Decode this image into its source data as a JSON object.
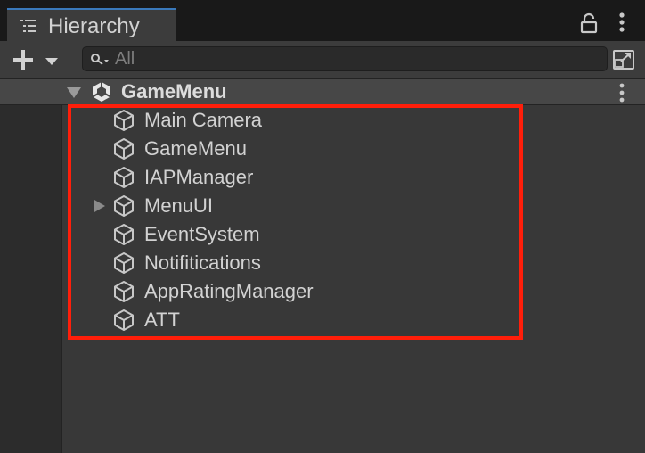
{
  "panel": {
    "tab_title": "Hierarchy",
    "tab_icon": "hierarchy-list-icon",
    "lock_icon": "lock-icon",
    "menu_icon": "kebab-menu-icon"
  },
  "toolbar": {
    "add_icon": "plus-icon",
    "dropdown_icon": "chevron-down-icon",
    "search_placeholder": "All",
    "search_icon": "search-icon",
    "scene_picker_icon": "scene-picker-icon"
  },
  "scene": {
    "name": "GameMenu",
    "icon": "unity-scene-icon",
    "expanded": true,
    "menu_icon": "kebab-menu-icon"
  },
  "hierarchy": {
    "items": [
      {
        "label": "Main Camera",
        "icon": "gameobject-cube-icon",
        "has_children": false
      },
      {
        "label": "GameMenu",
        "icon": "gameobject-cube-icon",
        "has_children": false
      },
      {
        "label": "IAPManager",
        "icon": "gameobject-cube-icon",
        "has_children": false
      },
      {
        "label": "MenuUI",
        "icon": "gameobject-cube-icon",
        "has_children": true
      },
      {
        "label": "EventSystem",
        "icon": "gameobject-cube-icon",
        "has_children": false
      },
      {
        "label": "Notifitications",
        "icon": "gameobject-cube-icon",
        "has_children": false
      },
      {
        "label": "AppRatingManager",
        "icon": "gameobject-cube-icon",
        "has_children": false
      },
      {
        "label": "ATT",
        "icon": "gameobject-cube-icon",
        "has_children": false
      }
    ]
  },
  "colors": {
    "tab_accent": "#3a79bb",
    "highlight": "#ff1e0a",
    "text": "#d2d2d2"
  }
}
